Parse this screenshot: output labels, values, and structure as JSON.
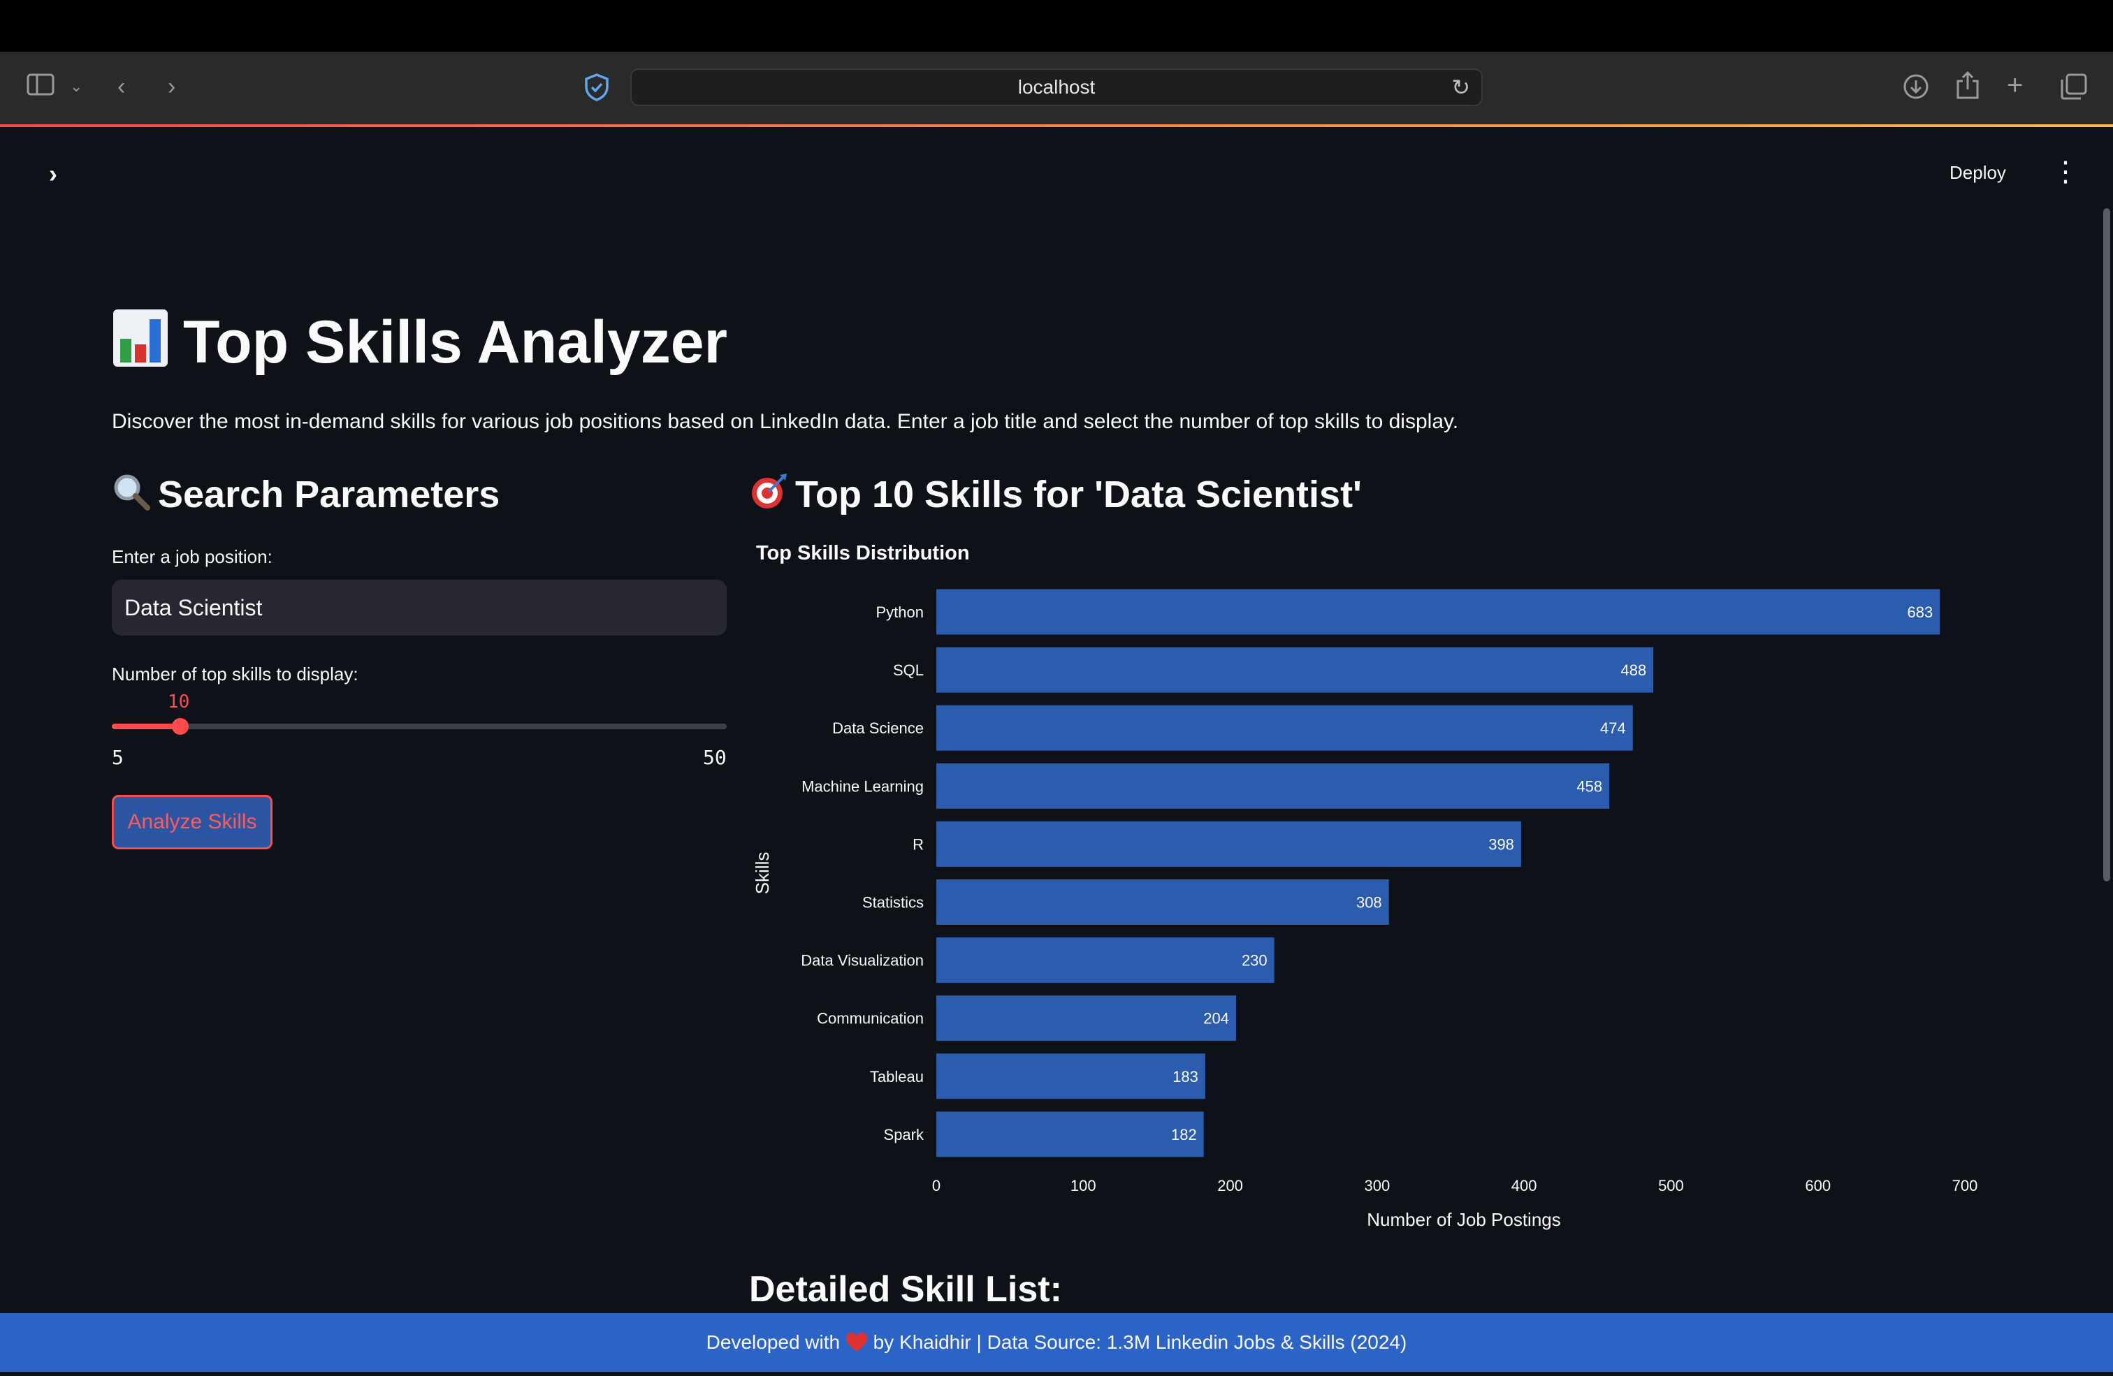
{
  "browser": {
    "url": "localhost"
  },
  "app": {
    "deploy_label": "Deploy"
  },
  "page": {
    "title": "Top Skills Analyzer",
    "intro": "Discover the most in-demand skills for various job positions based on LinkedIn data. Enter a job title and select the number of top skills to display."
  },
  "search": {
    "heading": "Search Parameters",
    "job_label": "Enter a job position:",
    "job_value": "Data Scientist",
    "slider_label": "Number of top skills to display:",
    "slider_value": "10",
    "slider_min": "5",
    "slider_max": "50",
    "analyze_label": "Analyze Skills"
  },
  "results": {
    "heading": "Top 10 Skills for 'Data Scientist'",
    "detailed_heading": "Detailed Skill List:"
  },
  "chart_data": {
    "type": "bar",
    "orientation": "horizontal",
    "title": "Top Skills Distribution",
    "xlabel": "Number of Job Postings",
    "ylabel": "Skills",
    "categories": [
      "Python",
      "SQL",
      "Data Science",
      "Machine Learning",
      "R",
      "Statistics",
      "Data Visualization",
      "Communication",
      "Tableau",
      "Spark"
    ],
    "values": [
      683,
      488,
      474,
      458,
      398,
      308,
      230,
      204,
      183,
      182
    ],
    "xlim": [
      0,
      700
    ],
    "xticks": [
      "0",
      "100",
      "200",
      "300",
      "400",
      "500",
      "600",
      "700"
    ],
    "bar_color": "#2b5cad",
    "grid": false
  },
  "footer": {
    "text_before": "Developed with",
    "text_after": "by Khaidhir | Data Source: 1.3M Linkedin Jobs & Skills (2024)"
  }
}
